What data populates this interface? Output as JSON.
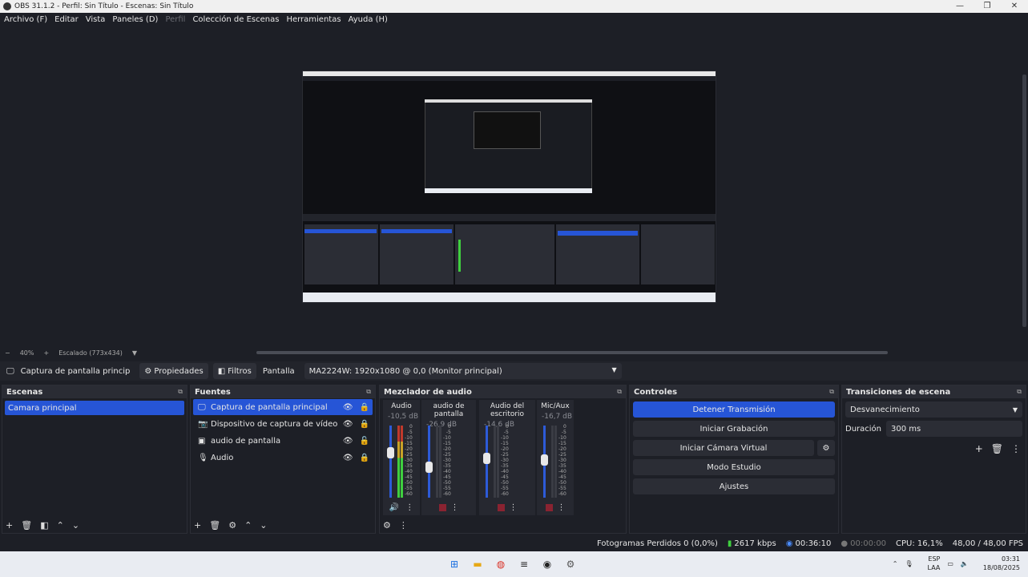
{
  "window": {
    "title": "OBS 31.1.2 - Perfil: Sin Título - Escenas: Sin Título",
    "minimize": "—",
    "restore": "❐",
    "close": "✕"
  },
  "menu": [
    "Archivo (F)",
    "Editar",
    "Vista",
    "Paneles (D)",
    "Perfil",
    "Colección de Escenas",
    "Herramientas",
    "Ayuda (H)"
  ],
  "zoom": {
    "minus": "−",
    "value": "40%",
    "plus": "+",
    "scaled": "Escalado (773x434)",
    "arrow": "▼"
  },
  "source_bar": {
    "source_name": "Captura de pantalla princip",
    "properties": "Propiedades",
    "filters": "Filtros",
    "display_label": "Pantalla",
    "display_value": "MA2224W: 1920x1080 @ 0,0 (Monitor principal)"
  },
  "scenes": {
    "title": "Escenas",
    "items": [
      "Camara principal"
    ]
  },
  "sources": {
    "title": "Fuentes",
    "items": [
      {
        "label": "Captura de pantalla principal",
        "icon": "monitor-icon"
      },
      {
        "label": "Dispositivo de captura de vídeo",
        "icon": "camera-icon"
      },
      {
        "label": "audio de pantalla",
        "icon": "speaker-box-icon"
      },
      {
        "label": "Audio",
        "icon": "microphone-icon"
      }
    ]
  },
  "mixer": {
    "title": "Mezclador de audio",
    "channels": [
      {
        "name": "Audio",
        "db": "-10,5 dB",
        "level": 0.62
      },
      {
        "name": "audio de pantalla",
        "db": "-26,9 dB",
        "level": 0.42
      },
      {
        "name": "Audio del escritorio",
        "db": "-14,6 dB",
        "level": 0.55
      },
      {
        "name": "Mic/Aux",
        "db": "-16,7 dB",
        "level": 0.52
      }
    ],
    "scale": [
      "0",
      "-5",
      "-10",
      "-15",
      "-20",
      "-25",
      "-30",
      "-35",
      "-40",
      "-45",
      "-50",
      "-55",
      "-60"
    ]
  },
  "controls": {
    "title": "Controles",
    "stop_stream": "Detener Transmisión",
    "start_record": "Iniciar Grabación",
    "start_vcam": "Iniciar Cámara Virtual",
    "studio_mode": "Modo Estudio",
    "settings": "Ajustes"
  },
  "transitions": {
    "title": "Transiciones de escena",
    "value": "Desvanecimiento",
    "duration_label": "Duración",
    "duration_value": "300 ms"
  },
  "status": {
    "dropped": "Fotogramas Perdidos 0 (0,0%)",
    "bitrate": "2617 kbps",
    "stream_time": "00:36:10",
    "rec_time": "00:00:00",
    "cpu": "CPU: 16,1%",
    "fps": "48,00 / 48,00 FPS"
  },
  "taskbar": {
    "lang1": "ESP",
    "lang2": "LAA",
    "time": "03:31",
    "date": "18/08/2025"
  },
  "colors": {
    "accent": "#2655d6",
    "meter_green": "#3fcf3f",
    "meter_red": "#c0392b"
  }
}
